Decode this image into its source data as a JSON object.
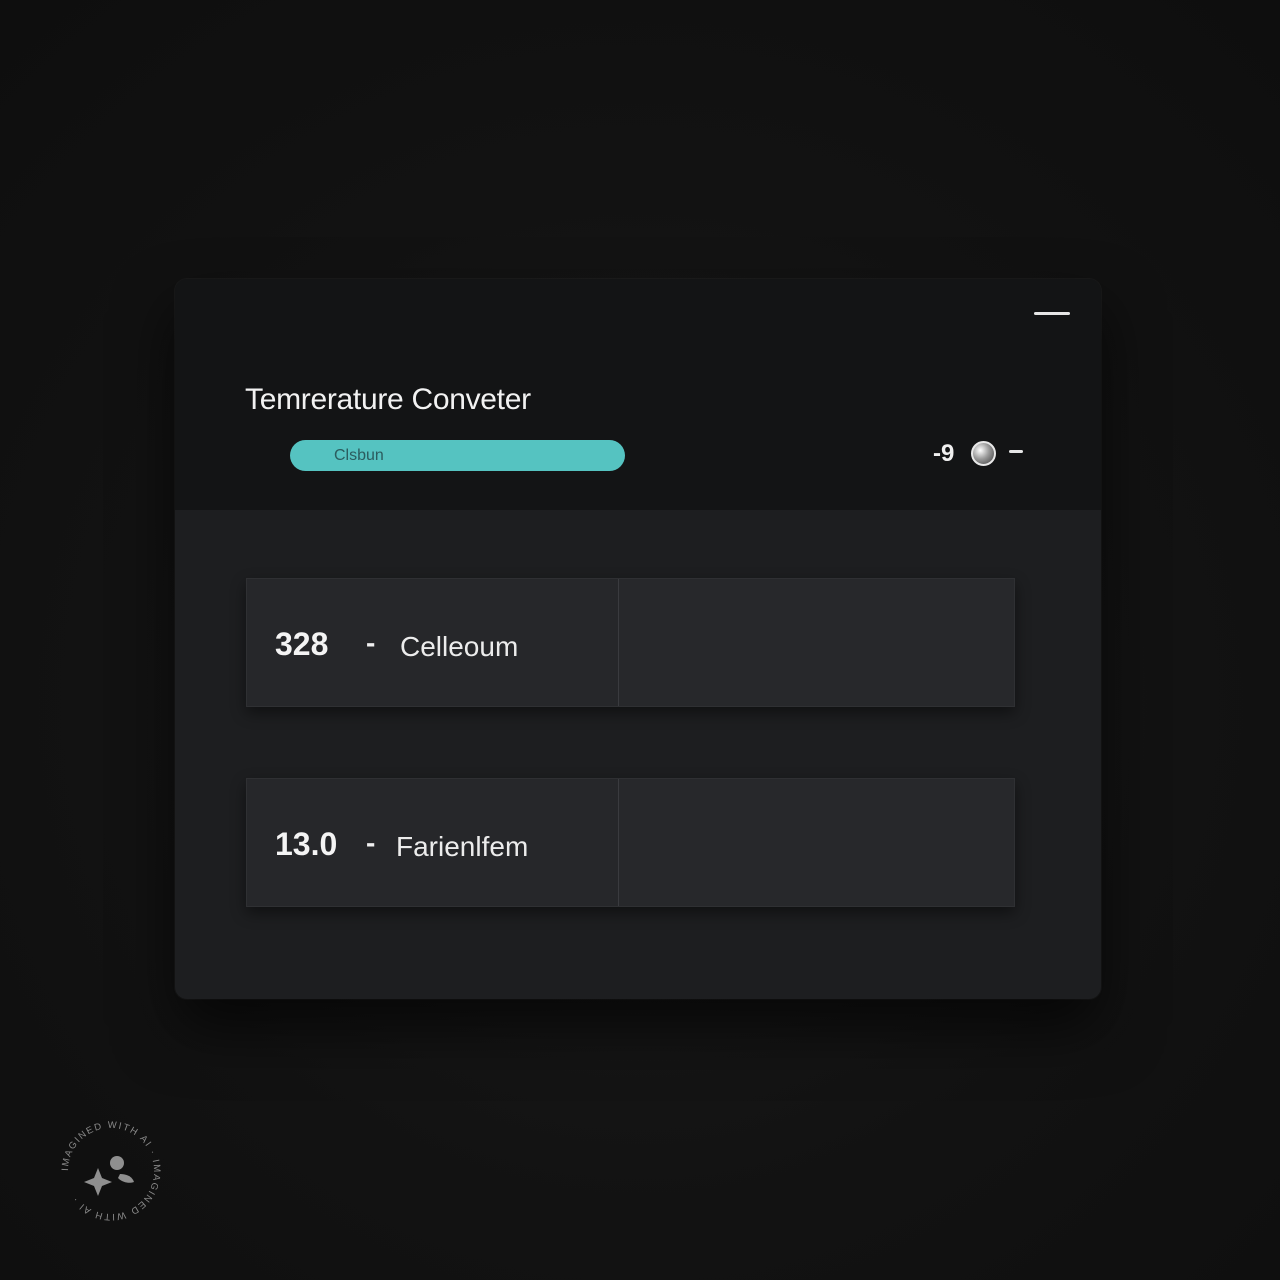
{
  "window": {
    "title": "Temrerature Conveter"
  },
  "header": {
    "unit_select_label": "Clsbun",
    "controls_glyph": "-9"
  },
  "results": [
    {
      "value": "328",
      "separator": "-",
      "unit": "Celleoum"
    },
    {
      "value": "13.0",
      "separator": "-",
      "unit": "Farienlfem"
    }
  ],
  "watermark": {
    "text": "IMAGINED WITH AI · IMAGINED WITH AI · "
  },
  "colors": {
    "background": "#121212",
    "window": "#161718",
    "accent": "#55c3c1",
    "row": "#26272a",
    "text": "#f2f2f2"
  },
  "icons": {
    "minimize": "minimize-icon",
    "theme_toggle": "theme-toggle-icon",
    "watermark": "sparkle-icon"
  }
}
